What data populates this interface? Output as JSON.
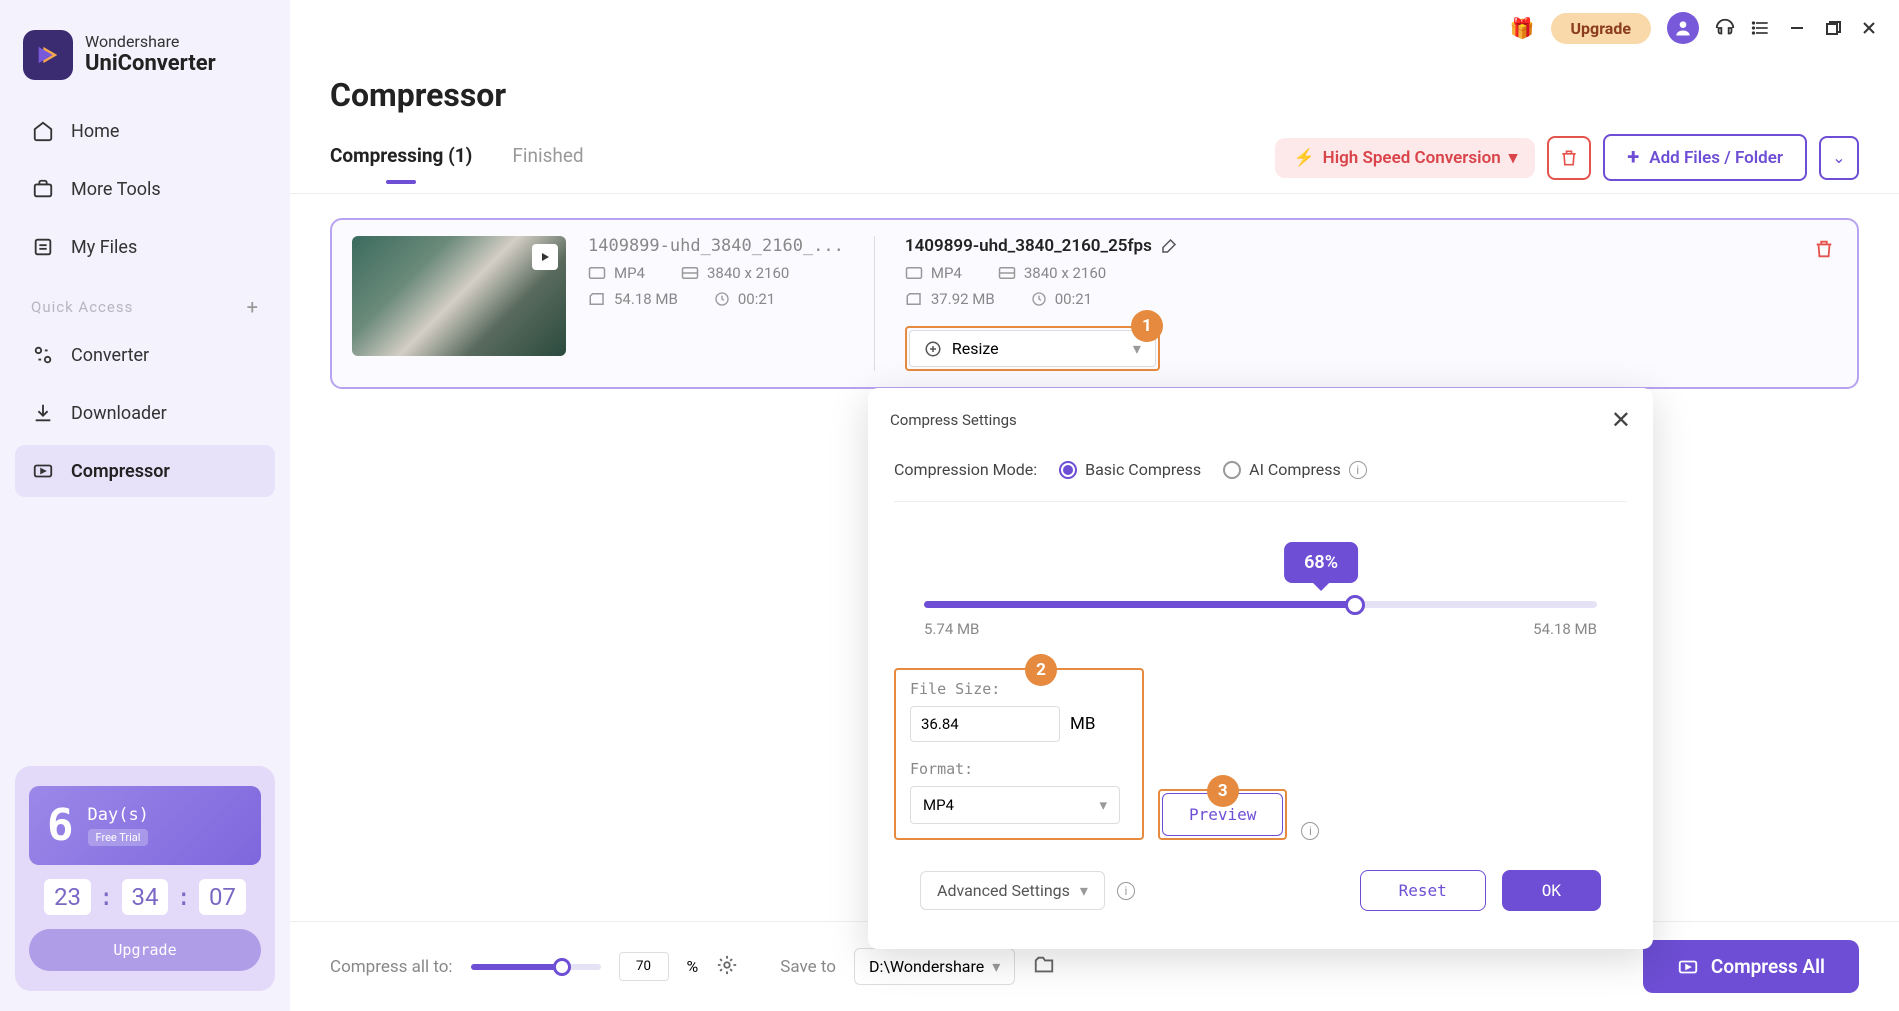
{
  "brand": {
    "company": "Wondershare",
    "product": "UniConverter"
  },
  "sidebar": {
    "items": [
      {
        "label": "Home"
      },
      {
        "label": "More Tools"
      },
      {
        "label": "My Files"
      }
    ],
    "quick_access": "Quick Access",
    "quick_items": [
      {
        "label": "Converter"
      },
      {
        "label": "Downloader"
      },
      {
        "label": "Compressor"
      }
    ],
    "trial": {
      "days": "6",
      "day_label": "Day(s)",
      "badge": "Free Trial",
      "countdown": {
        "h": "23",
        "m": "34",
        "s": "07"
      },
      "upgrade": "Upgrade"
    }
  },
  "titlebar": {
    "upgrade": "Upgrade"
  },
  "page": {
    "title": "Compressor"
  },
  "tabs": {
    "compressing": "Compressing (1)",
    "finished": "Finished"
  },
  "actions": {
    "high_speed": "High Speed Conversion",
    "add_files": "Add Files / Folder"
  },
  "file": {
    "src": {
      "name": "1409899-uhd_3840_2160_...",
      "format": "MP4",
      "resolution": "3840 x 2160",
      "size": "54.18 MB",
      "duration": "00:21"
    },
    "dst": {
      "name": "1409899-uhd_3840_2160_25fps",
      "format": "MP4",
      "resolution": "3840 x 2160",
      "size": "37.92 MB",
      "duration": "00:21",
      "resize": "Resize"
    }
  },
  "popup": {
    "title": "Compress Settings",
    "mode_label": "Compression Mode:",
    "mode_basic": "Basic Compress",
    "mode_ai": "AI Compress",
    "percent": "68%",
    "min_size": "5.74 MB",
    "max_size": "54.18 MB",
    "filesize_label": "File Size:",
    "filesize_value": "36.84",
    "filesize_unit": "MB",
    "format_label": "Format:",
    "format_value": "MP4",
    "preview": "Preview",
    "advanced": "Advanced Settings",
    "reset": "Reset",
    "ok": "OK"
  },
  "bottom": {
    "compress_all_to": "Compress all to:",
    "percent": "70",
    "percent_sign": "%",
    "save_to": "Save to",
    "path": "D:\\Wondershare",
    "compress_all": "Compress All"
  },
  "callouts": {
    "one": "1",
    "two": "2",
    "three": "3"
  }
}
